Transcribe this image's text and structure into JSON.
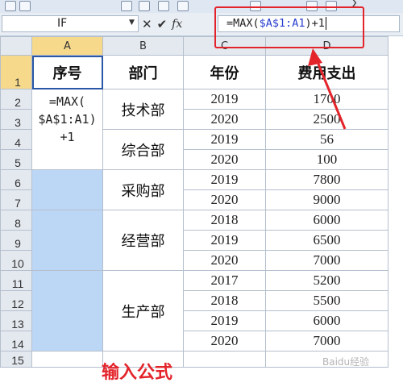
{
  "namebox": {
    "value": "IF"
  },
  "formula": {
    "prefix": "=MAX(",
    "ref": "$A$1:A1",
    "suffix": ")+1"
  },
  "fx_label": "fx",
  "columns": [
    "A",
    "B",
    "C",
    "D"
  ],
  "row_numbers": [
    "1",
    "2",
    "3",
    "4",
    "5",
    "6",
    "7",
    "8",
    "9",
    "10",
    "11",
    "12",
    "13",
    "14",
    "15"
  ],
  "headers": {
    "a": "序号",
    "b": "部门",
    "c": "年份",
    "d": "费用支出"
  },
  "a2_formula": {
    "line1": "=MAX(",
    "line2": "$A$1:A1)",
    "line3": "+1"
  },
  "departments": {
    "d1": "技术部",
    "d2": "综合部",
    "d3": "采购部",
    "d4": "经营部",
    "d5": "生产部"
  },
  "years": [
    "2019",
    "2020",
    "2019",
    "2020",
    "2019",
    "2020",
    "2018",
    "2019",
    "2020",
    "2017",
    "2018",
    "2019",
    "2020"
  ],
  "expenses": [
    "1700",
    "2500",
    "56",
    "100",
    "7800",
    "9000",
    "6000",
    "6500",
    "7000",
    "5200",
    "5500",
    "6000",
    "7000"
  ],
  "annotation": "输入公式",
  "watermark": "Baidu经验",
  "colors": {
    "highlight": "#e3242b",
    "selection": "#bcd7f6",
    "header_selected": "#f7d98c"
  }
}
